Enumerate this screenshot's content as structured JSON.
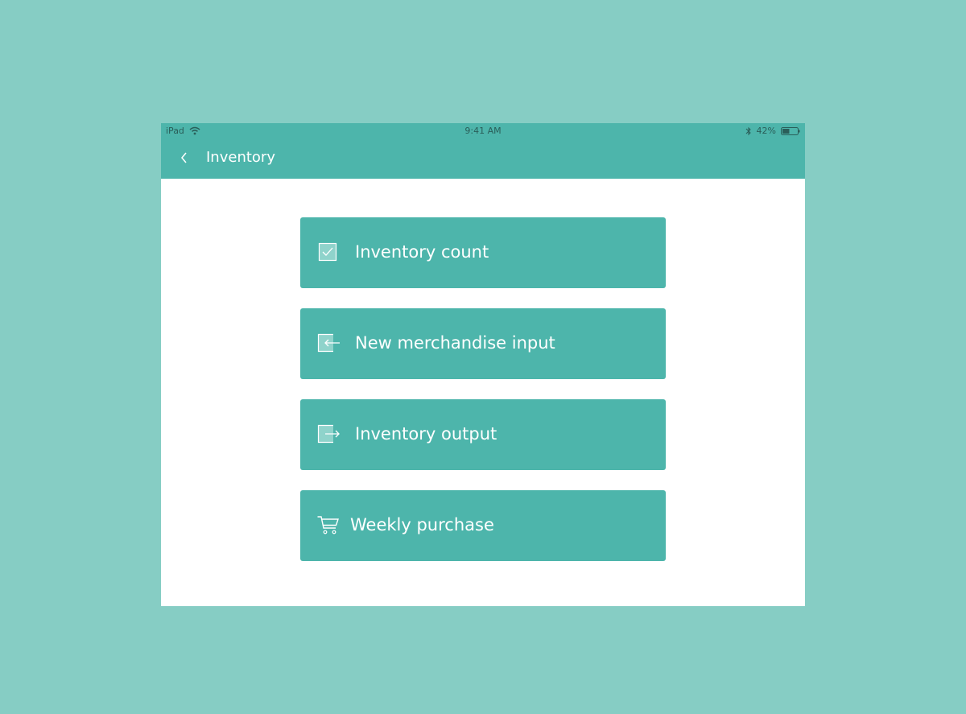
{
  "status_bar": {
    "device": "iPad",
    "time": "9:41 AM",
    "battery": "42%"
  },
  "nav": {
    "title": "Inventory"
  },
  "menu": {
    "items": [
      {
        "label": "Inventory count",
        "icon": "checkbox-icon"
      },
      {
        "label": "New merchandise input",
        "icon": "import-icon"
      },
      {
        "label": "Inventory output",
        "icon": "export-icon"
      },
      {
        "label": "Weekly purchase",
        "icon": "cart-icon"
      }
    ]
  },
  "colors": {
    "background": "#86cdc4",
    "accent": "#4db5ab",
    "surface": "#ffffff"
  }
}
